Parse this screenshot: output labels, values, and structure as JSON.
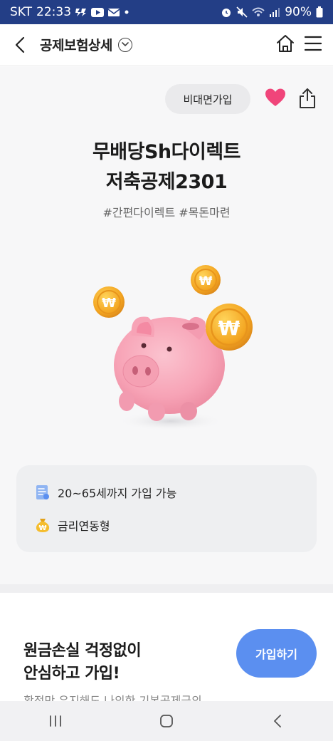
{
  "status_bar": {
    "carrier": "SKT",
    "time": "22:33",
    "battery": "90%",
    "icons": [
      "messenger-icon",
      "youtube-icon",
      "mail-icon",
      "dot-icon",
      "alarm-icon",
      "mute-icon",
      "wifi-icon",
      "signal-icon",
      "battery-icon"
    ]
  },
  "header": {
    "title": "공제보험상세",
    "icons": [
      "back-icon",
      "chevron-down-icon",
      "home-icon",
      "menu-icon"
    ]
  },
  "product": {
    "channel_tag": "비대면가입",
    "title_line1": "무배당Sh다이렉트",
    "title_line2": "저축공제2301",
    "hashtags": "#간편다이렉트 #목돈마련",
    "image": "piggy-bank-with-won-coins"
  },
  "info": {
    "age_range": "20~65세까지 가입 가능",
    "rate_type": "금리연동형",
    "icons": [
      "document-icon",
      "money-bag-icon"
    ]
  },
  "promo": {
    "title_line1": "원금손실 걱정없이",
    "title_line2": "안심하고 가입!",
    "subtitle_partial": "확정만 유지해도 나의한 기본공제금의",
    "join_label": "가입하기"
  },
  "colors": {
    "status_bar": "#233e86",
    "accent_blue": "#5b8ff0",
    "heart_pink": "#f0457a",
    "coin_gold": "#f3a521",
    "piggy_pink": "#f7a3b6"
  }
}
